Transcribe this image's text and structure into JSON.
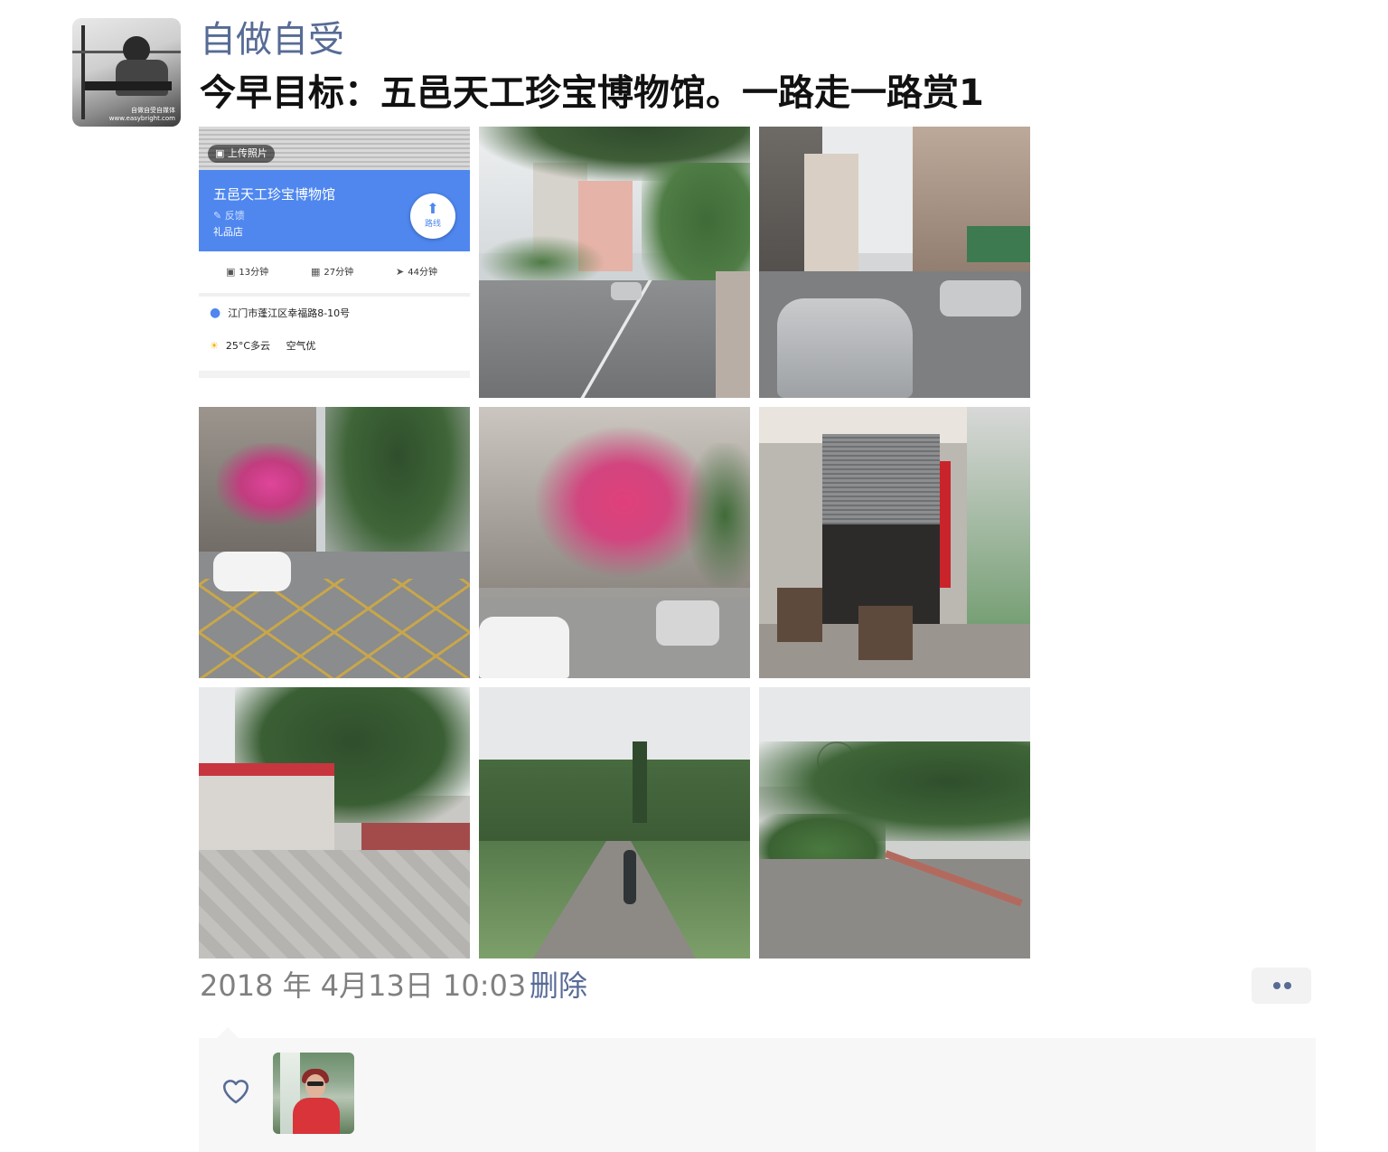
{
  "post": {
    "username": "自做自受",
    "text": "今早目标：五邑天工珍宝博物馆。一路走一路赏1",
    "timestamp": "2018 年 4月13日 10:03",
    "delete_label": "删除"
  },
  "avatar": {
    "caption_line1": "自做自受自媒体",
    "caption_line2": "www.easybright.com"
  },
  "map_card": {
    "upload_label": "上传照片",
    "place_name": "五邑天工珍宝博物馆",
    "feedback_label": "反馈",
    "category": "礼品店",
    "route_label": "路线",
    "drive_time": "13分钟",
    "bus_time": "27分钟",
    "walk_time": "44分钟",
    "address": "江门市蓬江区幸福路8-10号",
    "weather": "25°C多云",
    "air_quality": "空气优"
  },
  "photos": [
    {
      "icon": "map-screenshot"
    },
    {
      "icon": "street-photo"
    },
    {
      "icon": "street-photo"
    },
    {
      "icon": "street-photo"
    },
    {
      "icon": "building-photo"
    },
    {
      "icon": "shop-photo"
    },
    {
      "icon": "park-gate-photo"
    },
    {
      "icon": "park-path-photo"
    },
    {
      "icon": "park-path-photo"
    }
  ],
  "colors": {
    "link": "#576b95",
    "map_blue": "#4f87ef",
    "likes_bg": "#f7f7f7"
  }
}
